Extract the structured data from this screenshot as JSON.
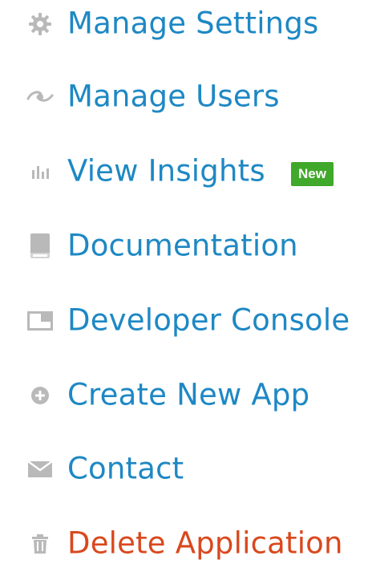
{
  "colors": {
    "link": "#1e88c4",
    "danger": "#d9481e",
    "icon": "#b9b9b9",
    "badge_bg": "#40a82a",
    "badge_text": "#ffffff"
  },
  "menu": {
    "items": [
      {
        "label": "Manage Settings",
        "icon": "gear-icon"
      },
      {
        "label": "Manage Users",
        "icon": "users-icon"
      },
      {
        "label": "View Insights",
        "icon": "bar-chart-icon",
        "badge": "New"
      },
      {
        "label": "Documentation",
        "icon": "book-icon"
      },
      {
        "label": "Developer Console",
        "icon": "console-icon"
      },
      {
        "label": "Create New App",
        "icon": "plus-circle-icon"
      },
      {
        "label": "Contact",
        "icon": "envelope-icon"
      },
      {
        "label": "Delete Application",
        "icon": "trash-icon"
      }
    ]
  }
}
